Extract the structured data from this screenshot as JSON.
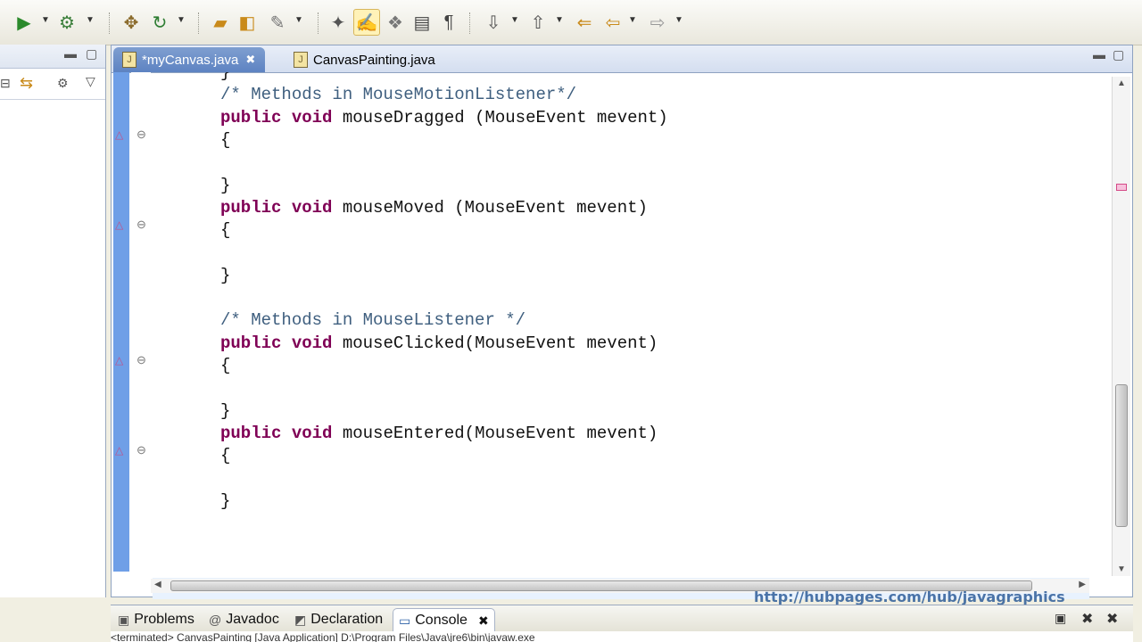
{
  "toolbar": {
    "buttons": [
      "run-icon",
      "run-dropdown",
      "coverage-icon",
      "coverage-dropdown",
      "build-icon",
      "refresh-icon",
      "new-dropdown",
      "open-type-icon",
      "open-resource-icon",
      "search-icon",
      "search-dropdown",
      "annotation-icon",
      "highlight-icon",
      "breadcrumb-icon",
      "toggle-icon",
      "pilcrow-icon",
      "next-annotation-icon",
      "prev-annotation-icon",
      "back-icon",
      "back-dropdown",
      "forward-icon",
      "forward-dropdown"
    ]
  },
  "editor": {
    "tabs": [
      {
        "label": "*myCanvas.java",
        "active": true
      },
      {
        "label": "CanvasPainting.java",
        "active": false
      }
    ],
    "code_lines": [
      {
        "text": "}",
        "indent": 2
      },
      {
        "text": "/* Methods in MouseMotionListener*/",
        "indent": 2,
        "type": "comment"
      },
      {
        "text": "public void mouseDragged (MouseEvent mevent)",
        "indent": 2,
        "type": "method"
      },
      {
        "text": "{",
        "indent": 2
      },
      {
        "text": "",
        "indent": 2
      },
      {
        "text": "}",
        "indent": 2
      },
      {
        "text": "public void mouseMoved (MouseEvent mevent)",
        "indent": 2,
        "type": "method"
      },
      {
        "text": "{",
        "indent": 2
      },
      {
        "text": "",
        "indent": 2
      },
      {
        "text": "}",
        "indent": 2
      },
      {
        "text": "",
        "indent": 2
      },
      {
        "text": "/* Methods in MouseListener */",
        "indent": 2,
        "type": "comment"
      },
      {
        "text": "public void mouseClicked(MouseEvent mevent)",
        "indent": 2,
        "type": "method"
      },
      {
        "text": "{",
        "indent": 2
      },
      {
        "text": "",
        "indent": 2
      },
      {
        "text": "}",
        "indent": 2
      },
      {
        "text": "public void mouseEntered(MouseEvent mevent)",
        "indent": 2,
        "type": "method"
      },
      {
        "text": "{",
        "indent": 2
      },
      {
        "text": "",
        "indent": 2
      },
      {
        "text": "}",
        "indent": 2
      }
    ]
  },
  "watermark": "http://hubpages.com/hub/javagraphics",
  "bottom_panel": {
    "tabs": [
      {
        "label": "Problems",
        "icon": "problems-icon"
      },
      {
        "label": "Javadoc",
        "icon": "at-icon"
      },
      {
        "label": "Declaration",
        "icon": "declaration-icon"
      },
      {
        "label": "Console",
        "icon": "console-icon",
        "active": true
      }
    ],
    "status": "<terminated> CanvasPainting [Java Application] D:\\Program Files\\Java\\jre6\\bin\\javaw.exe"
  },
  "colors": {
    "keyword": "#7f0055",
    "comment": "#3f5f7f",
    "ruler": "#6f9fe7",
    "current_line": "#e8f2fe"
  }
}
